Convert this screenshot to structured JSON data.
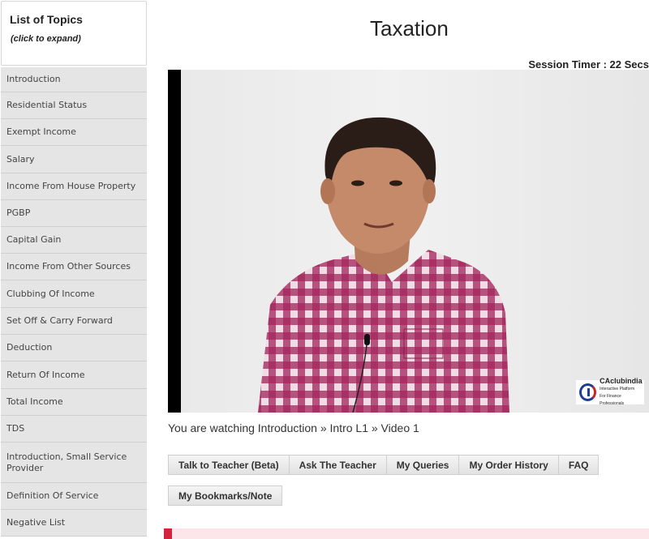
{
  "sidebar": {
    "title": "List of Topics",
    "subtitle": "(click to expand)",
    "topics": [
      "Introduction",
      "Residential Status",
      "Exempt Income",
      "Salary",
      "Income From House Property",
      "PGBP",
      "Capital Gain",
      "Income From Other Sources",
      "Clubbing Of Income",
      "Set Off & Carry Forward",
      "Deduction",
      "Return Of Income",
      "Total Income",
      "TDS",
      "Introduction, Small Service Provider",
      "Definition Of Service",
      "Negative List"
    ]
  },
  "page": {
    "title": "Taxation",
    "timer": "Session Timer : 22 Secs"
  },
  "video": {
    "logo_name": "CAclubindia",
    "logo_tagline1": "Interactive Platform",
    "logo_tagline2": "For Finance Professionals",
    "watching": "You are watching Introduction » Intro L1 » Video 1"
  },
  "tabs": [
    "Talk to Teacher (Beta)",
    "Ask The Teacher",
    "My Queries",
    "My Order History",
    "FAQ"
  ],
  "bookmark_label": "My Bookmarks/Note",
  "colors": {
    "sidebar_item_bg": "#e5e5e5",
    "accent_red": "#d4233f",
    "logo_blue": "#1e3f8f"
  }
}
